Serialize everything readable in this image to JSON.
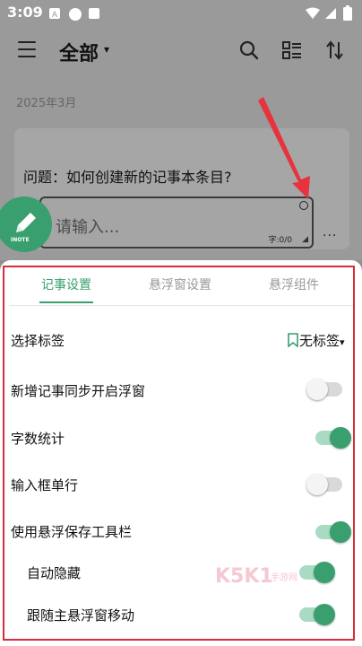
{
  "status_bar": {
    "time": "3:09"
  },
  "app_bar": {
    "title": "全部",
    "title_caret": "▾"
  },
  "list": {
    "month_header": "2025年3月",
    "note_question": "问题：如何创建新的记事本条目?",
    "input_placeholder": "请输入...",
    "char_counter": "字:0/0",
    "more_menu": "···",
    "fab_label": "INOTE"
  },
  "settings_sheet": {
    "tabs": [
      {
        "label": "记事设置",
        "active": true
      },
      {
        "label": "悬浮窗设置",
        "active": false
      },
      {
        "label": "悬浮组件",
        "active": false
      }
    ],
    "select_tag": {
      "label": "选择标签",
      "value": "无标签",
      "caret": "▾"
    },
    "rows": [
      {
        "label": "新增记事同步开启浮窗",
        "on": false
      },
      {
        "label": "字数统计",
        "on": true
      },
      {
        "label": "输入框单行",
        "on": false
      },
      {
        "label": "使用悬浮保存工具栏",
        "on": true
      },
      {
        "label": "自动隐藏",
        "on": true
      },
      {
        "label": "跟随主悬浮窗移动",
        "on": true
      }
    ]
  },
  "watermark": {
    "text": "K5K1",
    "sub": "手游网"
  },
  "colors": {
    "accent": "#3a9f6e",
    "highlight_frame": "#d62c3b",
    "arrow": "#e8323e"
  }
}
